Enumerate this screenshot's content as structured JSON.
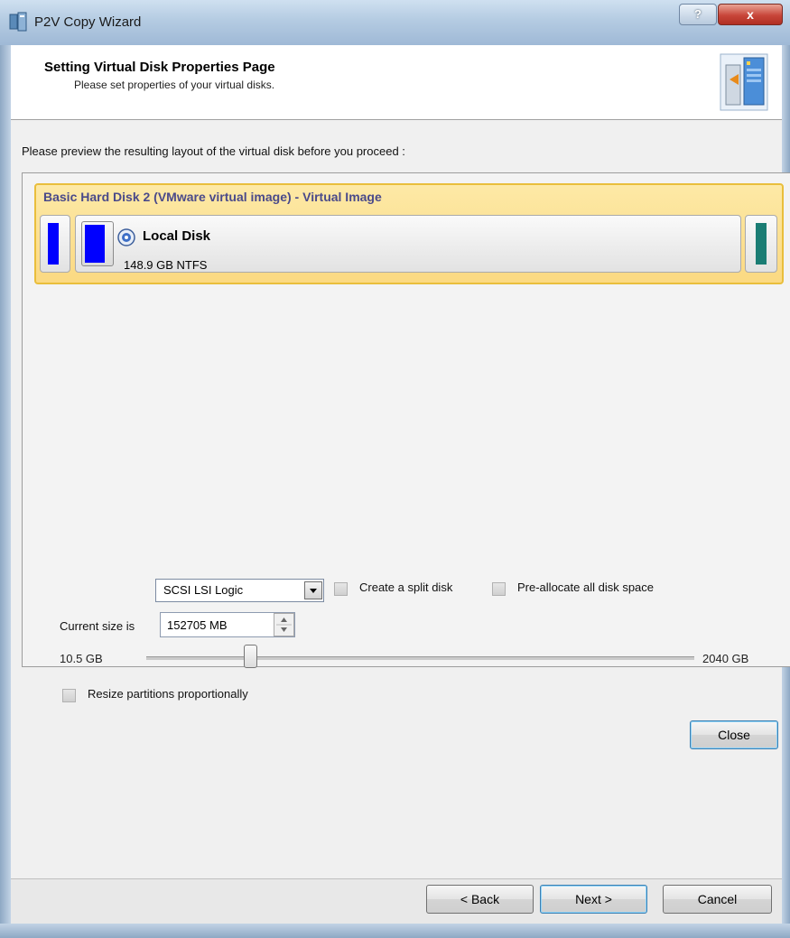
{
  "window": {
    "title": "P2V Copy Wizard",
    "help_symbol": "?",
    "close_symbol": "x"
  },
  "header": {
    "title": "Setting Virtual Disk Properties Page",
    "subtitle": "Please set properties of your virtual disks."
  },
  "preview": {
    "instruction": "Please preview the resulting layout of the virtual disk before you proceed :",
    "disk_name": "Basic Hard Disk 2 (VMware virtual image) - Virtual Image",
    "volume_label": "Local Disk",
    "volume_info": "148.9 GB NTFS",
    "colors": {
      "primary_bar": "#0000ff",
      "end_bar": "#1b7d74",
      "card_border": "#e9be3c"
    }
  },
  "options": {
    "controller_type": "SCSI LSI Logic",
    "split_disk_label": "Create a split disk",
    "preallocate_label": "Pre-allocate all disk space",
    "current_size_label": "Current size is",
    "current_size_value": "152705 MB",
    "slider_min_label": "10.5 GB",
    "slider_max_label": "2040 GB",
    "slider_position_fraction": 0.19,
    "resize_label": "Resize partitions proportionally"
  },
  "buttons": {
    "close": "Close",
    "back": "< Back",
    "next": "Next >",
    "cancel": "Cancel"
  }
}
